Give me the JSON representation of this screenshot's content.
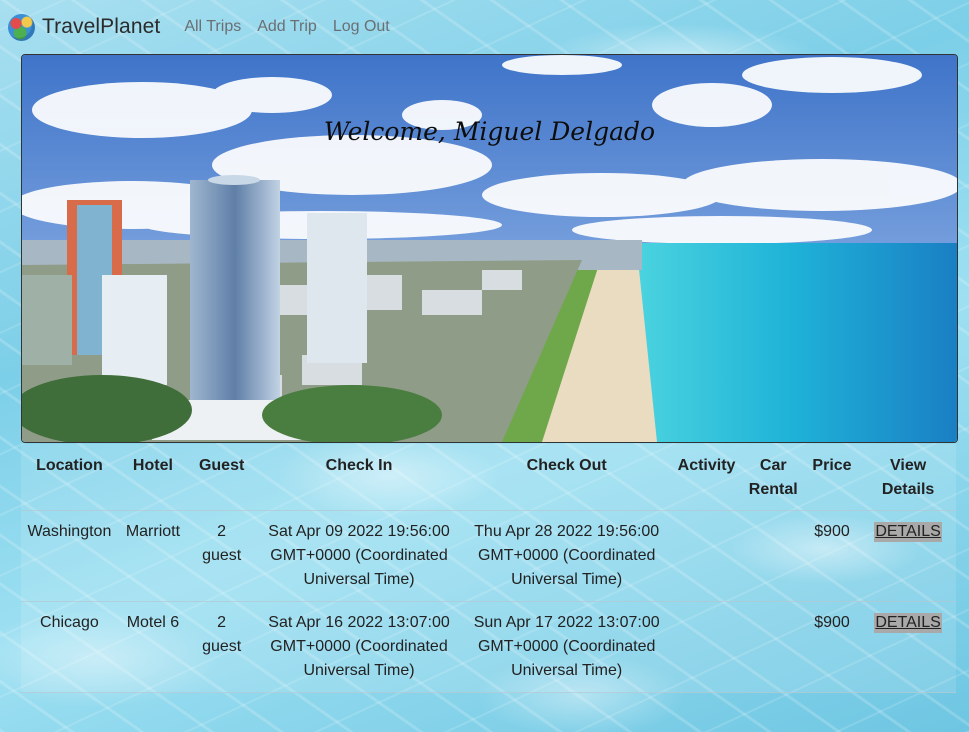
{
  "nav": {
    "brand": "TravelPlanet",
    "links": [
      "All Trips",
      "Add Trip",
      "Log Out"
    ]
  },
  "hero": {
    "welcome": "Welcome, Miguel Delgado"
  },
  "table": {
    "headers": [
      "Location",
      "Hotel",
      "Guest",
      "Check In",
      "Check Out",
      "Activity",
      "Car Rental",
      "Price",
      "View Details"
    ],
    "rows": [
      {
        "location": "Washington",
        "hotel": "Marriott",
        "guest": "2 guest",
        "check_in": "Sat Apr 09 2022 19:56:00 GMT+0000 (Coordinated Universal Time)",
        "check_out": "Thu Apr 28 2022 19:56:00 GMT+0000 (Coordinated Universal Time)",
        "activity": "",
        "car_rental": "",
        "price": "$900",
        "details": "DETAILS"
      },
      {
        "location": "Chicago",
        "hotel": "Motel 6",
        "guest": "2 guest",
        "check_in": "Sat Apr 16 2022 13:07:00 GMT+0000 (Coordinated Universal Time)",
        "check_out": "Sun Apr 17 2022 13:07:00 GMT+0000 (Coordinated Universal Time)",
        "activity": "",
        "car_rental": "",
        "price": "$900",
        "details": "DETAILS"
      }
    ]
  }
}
